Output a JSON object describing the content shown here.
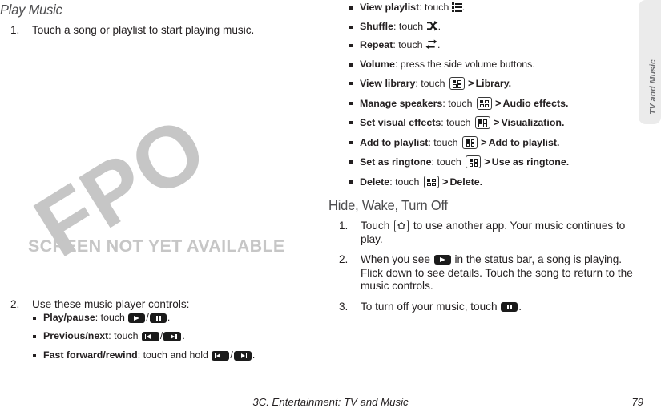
{
  "page": {
    "footer_title": "3C. Entertainment: TV and Music",
    "footer_page": "79",
    "side_tab_label": "TV and Music"
  },
  "placeholder": {
    "watermark": "FPO",
    "caption": "SCREEN NOT YET AVAILABLE"
  },
  "left_column": {
    "heading": "Play Music",
    "step1": {
      "num": "1.",
      "text": "Touch a song or playlist to start playing music."
    },
    "step2": {
      "num": "2.",
      "text": "Use these music player controls:",
      "bullets": [
        {
          "term": "Play/pause",
          "lead": ": touch ",
          "tail": "."
        },
        {
          "term": "Previous/next",
          "lead": ": touch ",
          "tail": "."
        },
        {
          "term": "Fast forward/rewind",
          "lead": ": touch and hold ",
          "tail": "."
        }
      ]
    }
  },
  "right_column": {
    "bullets": [
      {
        "term": "View playlist",
        "lead": ": touch ",
        "tail": "."
      },
      {
        "term": "Shuffle",
        "lead": ": touch ",
        "tail": "."
      },
      {
        "term": "Repeat",
        "lead": ": touch ",
        "tail": "."
      },
      {
        "term": "Volume",
        "lead": ": press the side volume buttons.",
        "tail": ""
      },
      {
        "term": "View library",
        "lead": ": touch ",
        "chev": ">",
        "target": "Library",
        "tail": "."
      },
      {
        "term": "Manage speakers",
        "lead": ": touch ",
        "chev": ">",
        "target": "Audio effects",
        "tail": "."
      },
      {
        "term": "Set visual effects",
        "lead": ": touch ",
        "chev": ">",
        "target": "Visualization",
        "tail": "."
      },
      {
        "term": "Add to playlist",
        "lead": ": touch ",
        "chev": ">",
        "target": "Add to playlist",
        "tail": "."
      },
      {
        "term": "Set as ringtone",
        "lead": ": touch ",
        "chev": ">",
        "target": "Use as ringtone",
        "tail": "."
      },
      {
        "term": "Delete",
        "lead": ": touch ",
        "chev": ">",
        "target": "Delete",
        "tail": "."
      }
    ],
    "heading": "Hide, Wake, Turn Off",
    "steps": [
      {
        "num": "1.",
        "pre": "Touch ",
        "post": " to use another app. Your music continues to play."
      },
      {
        "num": "2.",
        "pre": "When you see ",
        "post": " in the status bar, a song is playing. Flick down to see details. Touch the song to return to the music controls."
      },
      {
        "num": "3.",
        "pre": "To turn off your music, touch ",
        "post": "."
      }
    ]
  },
  "icons": {
    "play": "play-icon",
    "pause": "pause-icon",
    "previous": "previous-track-icon",
    "next": "next-track-icon",
    "playlist": "playlist-icon",
    "shuffle": "shuffle-icon",
    "repeat": "repeat-icon",
    "menu": "menu-key-icon",
    "home": "home-key-icon"
  },
  "colors": {
    "heading": "#4d4d4f",
    "body": "#231f20",
    "placeholder": "#c6c6c6",
    "tab_bg": "#ebebeb",
    "tab_text": "#6d6e71"
  }
}
